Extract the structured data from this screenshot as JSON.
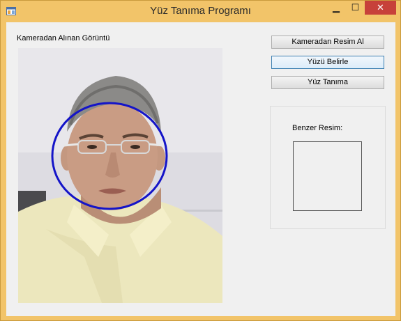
{
  "window": {
    "title": "Yüz Tanıma Programı",
    "minimize_glyph": "▁",
    "maximize_glyph": "☐",
    "close_glyph": "✕",
    "icon": "app-icon"
  },
  "camera": {
    "label": "Kameradan Alınan Görüntü",
    "detection_circle_color": "#1414c8"
  },
  "buttons": {
    "capture_label": "Kameradan Resim Al",
    "detect_face_label": "Yüzü Belirle",
    "recognize_label": "Yüz Tanıma"
  },
  "similar": {
    "label": "Benzer Resim:"
  },
  "colors": {
    "title_bar": "#f2c469",
    "close_button": "#c7413a",
    "focus_border": "#3c7fb1"
  }
}
